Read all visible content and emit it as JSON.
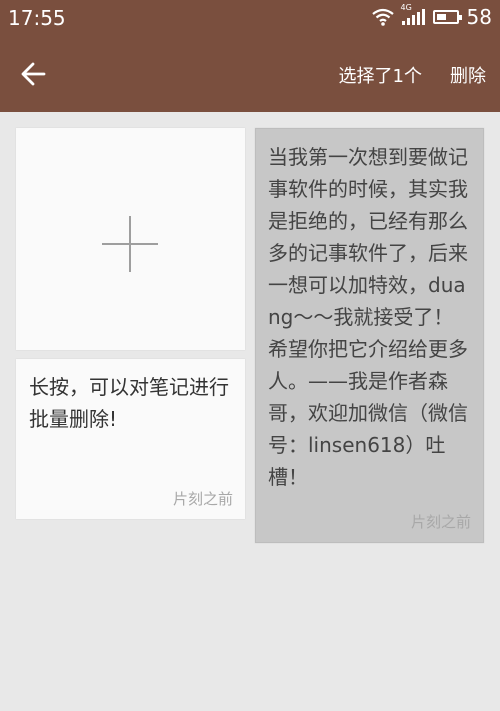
{
  "status": {
    "time": "17:55",
    "network": "4G",
    "battery": "58"
  },
  "appbar": {
    "selected": "选择了1个",
    "delete": "删除"
  },
  "notes": [
    {
      "text": "长按，可以对笔记进行批量删除!",
      "time": "片刻之前",
      "selected": false
    },
    {
      "text": "当我第一次想到要做记事软件的时候，其实我是拒绝的，已经有那么多的记事软件了，后来一想可以加特效，duang～～我就接受了！希望你把它介绍给更多人。——我是作者森哥，欢迎加微信（微信号：linsen618）吐槽！",
      "time": "片刻之前",
      "selected": true
    }
  ],
  "colors": {
    "primary": "#7a4f3e",
    "background": "#e8e8e8",
    "selected_card": "#c7c7c7"
  }
}
